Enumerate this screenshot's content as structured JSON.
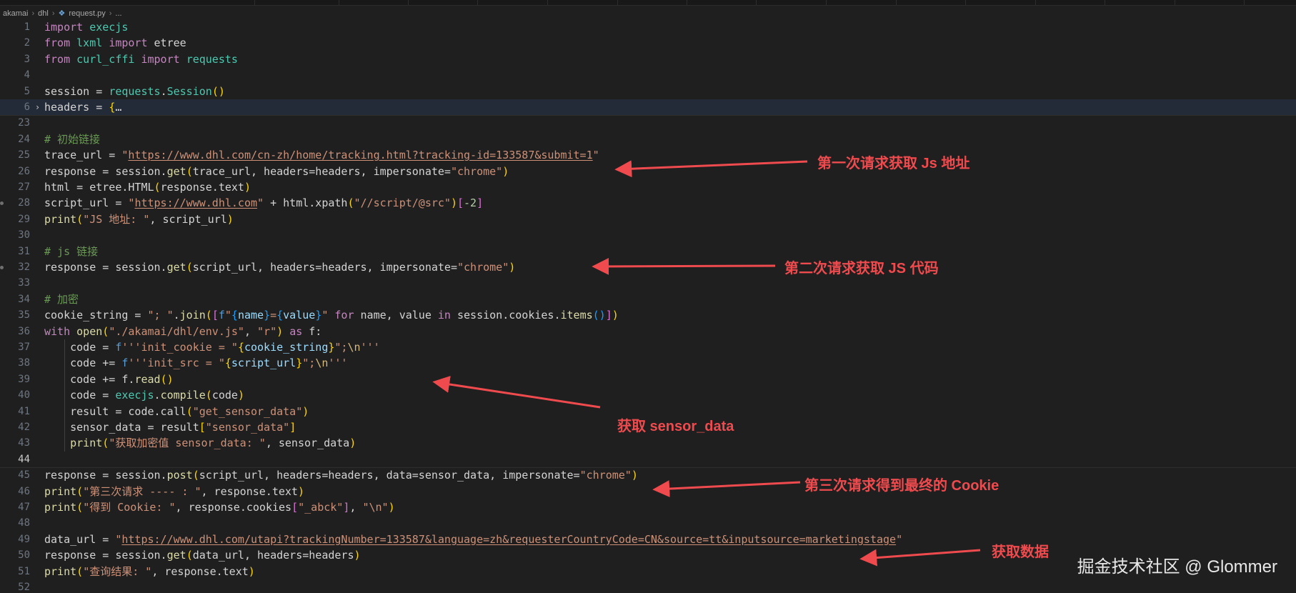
{
  "breadcrumb": {
    "folder1": "akamai",
    "folder2": "dhl",
    "file_icon": "python-file-icon",
    "file": "request.py",
    "more": "..."
  },
  "lines": [
    {
      "n": "1",
      "tokens": [
        [
          "kw",
          "import"
        ],
        [
          "p",
          " "
        ],
        [
          "mod",
          "execjs"
        ]
      ]
    },
    {
      "n": "2",
      "tokens": [
        [
          "kw",
          "from"
        ],
        [
          "p",
          " "
        ],
        [
          "mod",
          "lxml"
        ],
        [
          "p",
          " "
        ],
        [
          "kw",
          "import"
        ],
        [
          "p",
          " etree"
        ]
      ]
    },
    {
      "n": "3",
      "tokens": [
        [
          "kw",
          "from"
        ],
        [
          "p",
          " "
        ],
        [
          "mod",
          "curl_cffi"
        ],
        [
          "p",
          " "
        ],
        [
          "kw",
          "import"
        ],
        [
          "p",
          " "
        ],
        [
          "mod",
          "requests"
        ]
      ]
    },
    {
      "n": "4",
      "tokens": []
    },
    {
      "n": "5",
      "tokens": [
        [
          "p",
          "session = "
        ],
        [
          "mod",
          "requests"
        ],
        [
          "p",
          "."
        ],
        [
          "mod",
          "Session"
        ],
        [
          "br1",
          "()"
        ]
      ]
    },
    {
      "n": "6",
      "fold": true,
      "active": true,
      "tokens": [
        [
          "p",
          "headers = "
        ],
        [
          "br1",
          "{"
        ],
        [
          "p",
          "…"
        ]
      ]
    },
    {
      "n": "23",
      "tokens": []
    },
    {
      "n": "24",
      "tokens": [
        [
          "cm",
          "# 初始链接"
        ]
      ]
    },
    {
      "n": "25",
      "tokens": [
        [
          "p",
          "trace_url = "
        ],
        [
          "str",
          "\""
        ],
        [
          "url",
          "https://www.dhl.com/cn-zh/home/tracking.html?tracking-id=133587&submit=1"
        ],
        [
          "str",
          "\""
        ]
      ]
    },
    {
      "n": "26",
      "tokens": [
        [
          "p",
          "response = session."
        ],
        [
          "fn",
          "get"
        ],
        [
          "br1",
          "("
        ],
        [
          "p",
          "trace_url, headers=headers, impersonate="
        ],
        [
          "str",
          "\"chrome\""
        ],
        [
          "br1",
          ")"
        ]
      ]
    },
    {
      "n": "27",
      "tokens": [
        [
          "p",
          "html = etree.HTML"
        ],
        [
          "br1",
          "("
        ],
        [
          "p",
          "response.text"
        ],
        [
          "br1",
          ")"
        ]
      ]
    },
    {
      "n": "28",
      "dot": true,
      "tokens": [
        [
          "p",
          "script_url = "
        ],
        [
          "str",
          "\""
        ],
        [
          "url",
          "https://www.dhl.com"
        ],
        [
          "str",
          "\""
        ],
        [
          "p",
          " + html.xpath"
        ],
        [
          "br1",
          "("
        ],
        [
          "str",
          "\"//script/@src\""
        ],
        [
          "br1",
          ")"
        ],
        [
          "br2",
          "["
        ],
        [
          "num",
          "-2"
        ],
        [
          "br2",
          "]"
        ]
      ]
    },
    {
      "n": "29",
      "tokens": [
        [
          "fn",
          "print"
        ],
        [
          "br1",
          "("
        ],
        [
          "str",
          "\"JS 地址: \""
        ],
        [
          "p",
          ", script_url"
        ],
        [
          "br1",
          ")"
        ]
      ]
    },
    {
      "n": "30",
      "tokens": []
    },
    {
      "n": "31",
      "tokens": [
        [
          "cm",
          "# js 链接"
        ]
      ]
    },
    {
      "n": "32",
      "dot": true,
      "tokens": [
        [
          "p",
          "response = session."
        ],
        [
          "fn",
          "get"
        ],
        [
          "br1",
          "("
        ],
        [
          "p",
          "script_url, headers=headers, impersonate="
        ],
        [
          "str",
          "\"chrome\""
        ],
        [
          "br1",
          ")"
        ]
      ]
    },
    {
      "n": "33",
      "tokens": []
    },
    {
      "n": "34",
      "tokens": [
        [
          "cm",
          "# 加密"
        ]
      ]
    },
    {
      "n": "35",
      "tokens": [
        [
          "p",
          "cookie_string = "
        ],
        [
          "str",
          "\"; \""
        ],
        [
          "p",
          "."
        ],
        [
          "fn",
          "join"
        ],
        [
          "br1",
          "("
        ],
        [
          "br2",
          "["
        ],
        [
          "kw2",
          "f"
        ],
        [
          "str",
          "\""
        ],
        [
          "br3",
          "{"
        ],
        [
          "var",
          "name"
        ],
        [
          "br3",
          "}"
        ],
        [
          "str",
          "="
        ],
        [
          "br3",
          "{"
        ],
        [
          "var",
          "value"
        ],
        [
          "br3",
          "}"
        ],
        [
          "str",
          "\""
        ],
        [
          "p",
          " "
        ],
        [
          "kw",
          "for"
        ],
        [
          "p",
          " name, value "
        ],
        [
          "kw",
          "in"
        ],
        [
          "p",
          " session.cookies."
        ],
        [
          "fn",
          "items"
        ],
        [
          "br3",
          "()"
        ],
        [
          "br2",
          "]"
        ],
        [
          "br1",
          ")"
        ]
      ]
    },
    {
      "n": "36",
      "tokens": [
        [
          "kw",
          "with"
        ],
        [
          "p",
          " "
        ],
        [
          "fn",
          "open"
        ],
        [
          "br1",
          "("
        ],
        [
          "str",
          "\"./akamai/dhl/env.js\""
        ],
        [
          "p",
          ", "
        ],
        [
          "str",
          "\"r\""
        ],
        [
          "br1",
          ")"
        ],
        [
          "p",
          " "
        ],
        [
          "kw",
          "as"
        ],
        [
          "p",
          " f:"
        ]
      ]
    },
    {
      "n": "37",
      "indent": true,
      "tokens": [
        [
          "p",
          "    code = "
        ],
        [
          "kw2",
          "f"
        ],
        [
          "str",
          "'''init_cookie = \""
        ],
        [
          "br1",
          "{"
        ],
        [
          "var",
          "cookie_string"
        ],
        [
          "br1",
          "}"
        ],
        [
          "str",
          "\";"
        ],
        [
          "esc",
          "\\n"
        ],
        [
          "str",
          "'''"
        ]
      ]
    },
    {
      "n": "38",
      "indent": true,
      "tokens": [
        [
          "p",
          "    code += "
        ],
        [
          "kw2",
          "f"
        ],
        [
          "str",
          "'''init_src = \""
        ],
        [
          "br1",
          "{"
        ],
        [
          "var",
          "script_url"
        ],
        [
          "br1",
          "}"
        ],
        [
          "str",
          "\";"
        ],
        [
          "esc",
          "\\n"
        ],
        [
          "str",
          "'''"
        ]
      ]
    },
    {
      "n": "39",
      "indent": true,
      "tokens": [
        [
          "p",
          "    code += f."
        ],
        [
          "fn",
          "read"
        ],
        [
          "br1",
          "()"
        ]
      ]
    },
    {
      "n": "40",
      "indent": true,
      "tokens": [
        [
          "p",
          "    code = "
        ],
        [
          "mod",
          "execjs"
        ],
        [
          "p",
          "."
        ],
        [
          "fn",
          "compile"
        ],
        [
          "br1",
          "("
        ],
        [
          "p",
          "code"
        ],
        [
          "br1",
          ")"
        ]
      ]
    },
    {
      "n": "41",
      "indent": true,
      "tokens": [
        [
          "p",
          "    result = code.call"
        ],
        [
          "br1",
          "("
        ],
        [
          "str",
          "\"get_sensor_data\""
        ],
        [
          "br1",
          ")"
        ]
      ]
    },
    {
      "n": "42",
      "indent": true,
      "tokens": [
        [
          "p",
          "    sensor_data = result"
        ],
        [
          "br1",
          "["
        ],
        [
          "str",
          "\"sensor_data\""
        ],
        [
          "br1",
          "]"
        ]
      ]
    },
    {
      "n": "43",
      "indent": true,
      "tokens": [
        [
          "p",
          "    "
        ],
        [
          "fn",
          "print"
        ],
        [
          "br1",
          "("
        ],
        [
          "str",
          "\"获取加密值 sensor_data: \""
        ],
        [
          "p",
          ", sensor_data"
        ],
        [
          "br1",
          ")"
        ]
      ]
    },
    {
      "n": "44",
      "cur": true,
      "tokens": []
    },
    {
      "n": "45",
      "tokens": [
        [
          "p",
          "response = session."
        ],
        [
          "fn",
          "post"
        ],
        [
          "br1",
          "("
        ],
        [
          "p",
          "script_url, headers=headers, data=sensor_data, impersonate="
        ],
        [
          "str",
          "\"chrome\""
        ],
        [
          "br1",
          ")"
        ]
      ]
    },
    {
      "n": "46",
      "tokens": [
        [
          "fn",
          "print"
        ],
        [
          "br1",
          "("
        ],
        [
          "str",
          "\"第三次请求 ---- : \""
        ],
        [
          "p",
          ", response.text"
        ],
        [
          "br1",
          ")"
        ]
      ]
    },
    {
      "n": "47",
      "tokens": [
        [
          "fn",
          "print"
        ],
        [
          "br1",
          "("
        ],
        [
          "str",
          "\"得到 Cookie: \""
        ],
        [
          "p",
          ", response.cookies"
        ],
        [
          "br2",
          "["
        ],
        [
          "str",
          "\"_abck\""
        ],
        [
          "br2",
          "]"
        ],
        [
          "p",
          ", "
        ],
        [
          "str",
          "\"\\n\""
        ],
        [
          "br1",
          ")"
        ]
      ]
    },
    {
      "n": "48",
      "tokens": []
    },
    {
      "n": "49",
      "tokens": [
        [
          "p",
          "data_url = "
        ],
        [
          "str",
          "\""
        ],
        [
          "url",
          "https://www.dhl.com/utapi?trackingNumber=133587&language=zh&requesterCountryCode=CN&source=tt&inputsource=marketingstage"
        ],
        [
          "str",
          "\""
        ]
      ]
    },
    {
      "n": "50",
      "tokens": [
        [
          "p",
          "response = session."
        ],
        [
          "fn",
          "get"
        ],
        [
          "br1",
          "("
        ],
        [
          "p",
          "data_url, headers=headers"
        ],
        [
          "br1",
          ")"
        ]
      ]
    },
    {
      "n": "51",
      "tokens": [
        [
          "fn",
          "print"
        ],
        [
          "br1",
          "("
        ],
        [
          "str",
          "\"查询结果: \""
        ],
        [
          "p",
          ", response.text"
        ],
        [
          "br1",
          ")"
        ]
      ]
    },
    {
      "n": "52",
      "tokens": []
    }
  ],
  "annotations": [
    {
      "id": "first-request",
      "text": "第一次请求获取 Js 地址"
    },
    {
      "id": "second-request",
      "text": "第二次请求获取 JS 代码"
    },
    {
      "id": "sensor-data",
      "text": "获取 sensor_data"
    },
    {
      "id": "third-request",
      "text": "第三次请求得到最终的 Cookie"
    },
    {
      "id": "get-data",
      "text": "获取数据"
    }
  ],
  "annotation_color": "#ef4b4e",
  "watermark": "掘金技术社区 @ Glommer"
}
